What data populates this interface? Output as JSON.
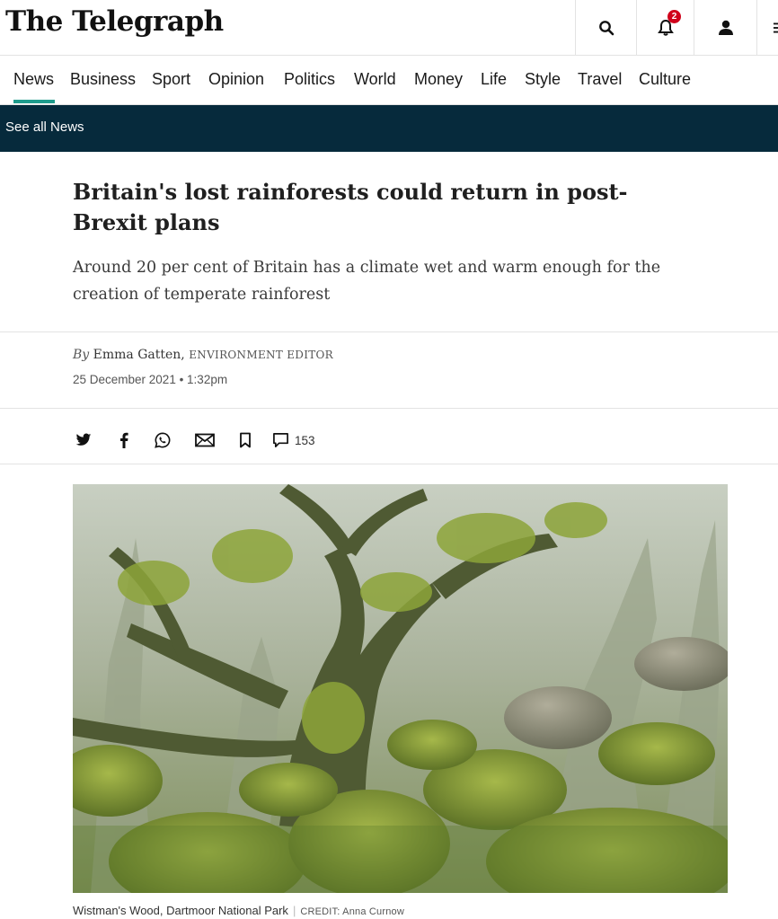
{
  "header": {
    "logo_text": "The Telegraph",
    "notification_count": "2",
    "icons": [
      "search-icon",
      "bell-icon",
      "user-icon",
      "menu-icon"
    ]
  },
  "nav": {
    "items": [
      "News",
      "Business",
      "Sport",
      "Opinion",
      "Politics",
      "World",
      "Money",
      "Life",
      "Style",
      "Travel",
      "Culture"
    ],
    "active": "News",
    "accent_color": "#1f9b8c"
  },
  "subnav": {
    "label": "See all News",
    "background": "#062a3c"
  },
  "article": {
    "headline": "Britain's lost rainforests could return in post-Brexit plans",
    "standfirst": "Around 20 per cent of Britain has a climate wet and warm enough for the creation of temperate rainforest",
    "byline_prefix": "By",
    "author": "Emma Gatten,",
    "author_role": "ENVIRONMENT EDITOR",
    "date": "25 December 2021 • 1:32pm"
  },
  "share": {
    "icons": [
      "twitter-icon",
      "facebook-icon",
      "whatsapp-icon",
      "email-icon",
      "bookmark-icon",
      "comment-icon"
    ],
    "comment_count": "153"
  },
  "image": {
    "caption": "Wistman's Wood, Dartmoor National Park",
    "credit": "CREDIT: Anna Curnow"
  }
}
